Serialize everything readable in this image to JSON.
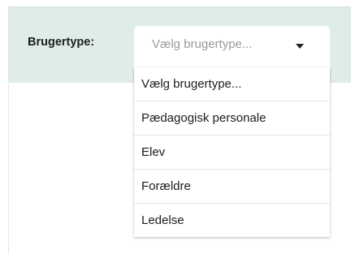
{
  "filter": {
    "label": "Brugertype:",
    "select": {
      "placeholder": "Vælg brugertype...",
      "options": [
        "Vælg brugertype...",
        "Pædagogisk personale",
        "Elev",
        "Forældre",
        "Ledelse"
      ]
    }
  },
  "colors": {
    "panel_background": "#dfecea",
    "placeholder_text": "#9a9a9a"
  }
}
